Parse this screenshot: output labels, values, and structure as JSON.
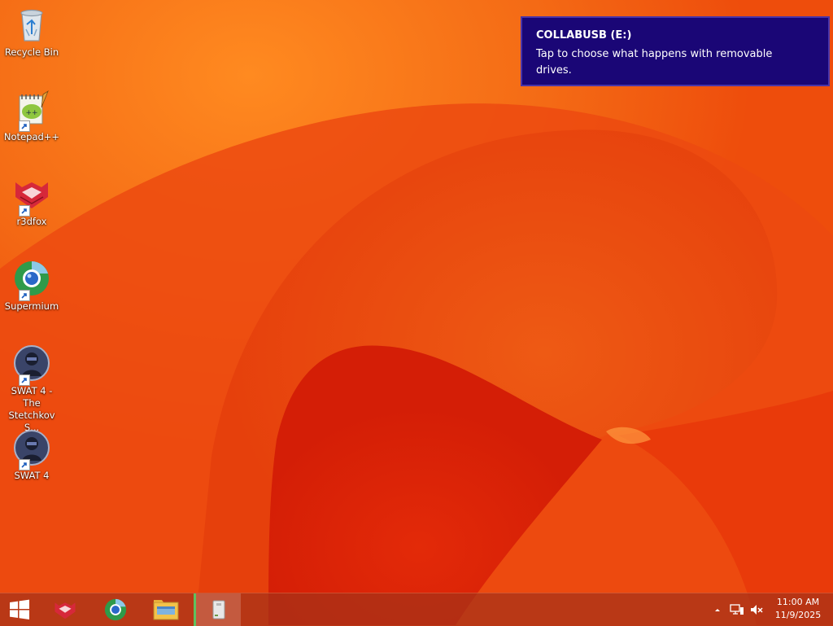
{
  "desktop": {
    "icons": [
      {
        "label": "Recycle Bin",
        "icon": "recycle-bin-icon"
      },
      {
        "label": "Notepad++",
        "icon": "notepad-plus-plus-icon"
      },
      {
        "label": "r3dfox",
        "icon": "r3dfox-icon"
      },
      {
        "label": "Supermium",
        "icon": "supermium-icon"
      },
      {
        "label": "SWAT 4 - The Stetchkov S...",
        "icon": "swat4-icon"
      },
      {
        "label": "SWAT 4",
        "icon": "swat4-icon"
      }
    ]
  },
  "notification": {
    "title": "COLLABUSB (E:)",
    "message": "Tap to choose what happens with removable drives.",
    "background": "#1a0676"
  },
  "taskbar": {
    "pinned": [
      "windows-logo-icon",
      "r3dfox-icon",
      "supermium-icon",
      "file-explorer-icon",
      "removable-drive-icon"
    ],
    "tray": [
      "show-hidden-icons-chevron",
      "network-icon",
      "volume-muted-icon"
    ],
    "clock": {
      "time": "11:00 AM",
      "date": "11/9/2025"
    }
  },
  "colors": {
    "wallpaper": "#f0400a",
    "accent_active": "#5ec25e"
  }
}
